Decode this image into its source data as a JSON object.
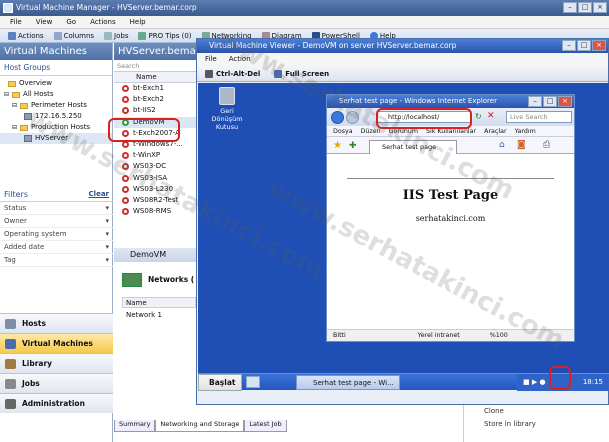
{
  "vmm": {
    "title": "Virtual Machine Manager - HVServer.bemar.corp",
    "menu": [
      "File",
      "View",
      "Go",
      "Actions",
      "Help"
    ],
    "toolbar": [
      "Actions",
      "Columns",
      "Jobs",
      "PRO Tips (0)",
      "Networking",
      "Diagram",
      "PowerShell",
      "Help"
    ]
  },
  "left": {
    "title": "Virtual Machines",
    "host_groups_label": "Host Groups",
    "tree": [
      "Overview",
      "All Hosts",
      "Perimeter Hosts",
      "172.16.5.250",
      "Production Hosts",
      "HVServer"
    ],
    "filters_label": "Filters",
    "clear_label": "Clear",
    "filters": [
      "Status",
      "Owner",
      "Operating system",
      "Added date",
      "Tag"
    ],
    "nav": [
      "Hosts",
      "Virtual Machines",
      "Library",
      "Jobs",
      "Administration"
    ]
  },
  "middle": {
    "title": "HVServer.bema",
    "search": "Search",
    "col_name": "Name",
    "vms": [
      "bt-Exch1",
      "bt-Exch2",
      "bt-IIS2",
      "DemoVM",
      "t-Exch2007-A",
      "t-Windows7-...",
      "t-WinXP",
      "WS03-DC",
      "WS03-ISA",
      "WS03-L230",
      "WS08R2-Test",
      "WS08-RMS"
    ],
    "selected_vm": "DemoVM",
    "detail_title": "DemoVM",
    "networks_label": "Networks (",
    "name_header": "Name",
    "network_item": "Network 1",
    "tabs": [
      "Summary",
      "Networking and Storage",
      "Latest Job"
    ]
  },
  "actions_bottom": [
    "Clone",
    "Store in library"
  ],
  "viewer": {
    "title": "Virtual Machine Viewer - DemoVM on server HVServer.bemar.corp",
    "menu": [
      "File",
      "Action"
    ],
    "ctrl_alt_del": "Ctrl-Alt-Del",
    "full_screen": "Full Screen",
    "recycle_bin": "Geri Dönüşüm Kutusu",
    "start": "Başlat",
    "task_item": "Serhat test page - Wi...",
    "clock": "18:15"
  },
  "ie": {
    "title": "Serhat test page - Windows Internet Explorer",
    "url": "http://localhost/",
    "search_placeholder": "Live Search",
    "menu": [
      "Dosya",
      "Düzen",
      "Görünüm",
      "Sık Kullanılanlar",
      "Araçlar",
      "Yardım"
    ],
    "tab": "Serhat test page",
    "page_title": "IIS Test Page",
    "page_sub": "serhatakinci.com",
    "status": [
      "Bitti",
      "Yerel intranet",
      "%100"
    ]
  },
  "watermark": "www.serhatakinci.com",
  "colors": {
    "highlight": "#d9211f",
    "desktop": "#1f4fb4",
    "vmm_header": "#4f70a5"
  }
}
